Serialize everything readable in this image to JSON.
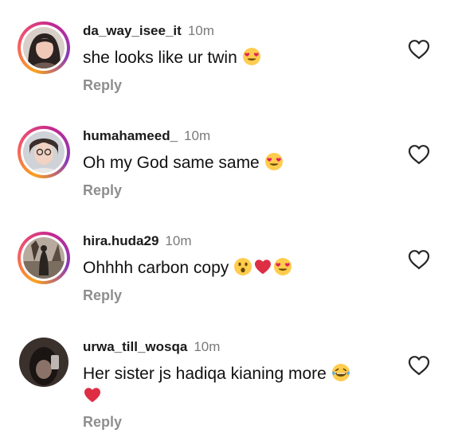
{
  "comments": [
    {
      "username": "da_way_isee_it",
      "time": "10m",
      "text": "she looks like ur twin",
      "emojis": [
        "heart-eyes"
      ],
      "reply_label": "Reply",
      "story_ring": true
    },
    {
      "username": "humahameed_",
      "time": "10m",
      "text": "Oh my God same same",
      "emojis": [
        "heart-eyes"
      ],
      "reply_label": "Reply",
      "story_ring": true
    },
    {
      "username": "hira.huda29",
      "time": "10m",
      "text": "Ohhhh carbon copy",
      "emojis": [
        "astonished",
        "red-heart",
        "heart-eyes"
      ],
      "reply_label": "Reply",
      "story_ring": true
    },
    {
      "username": "urwa_till_wosqa",
      "time": "10m",
      "text": "Her sister js hadiqa kianing more",
      "emojis": [
        "laughing-tears",
        "red-heart"
      ],
      "reply_label": "Reply",
      "story_ring": false
    }
  ],
  "icons": {
    "like": "heart-outline-icon"
  },
  "colors": {
    "username": "#1a1a1a",
    "time": "#7a7a7a",
    "reply": "#8e8e8e",
    "ring_start": "#f9a21c",
    "ring_end": "#c4288f"
  }
}
